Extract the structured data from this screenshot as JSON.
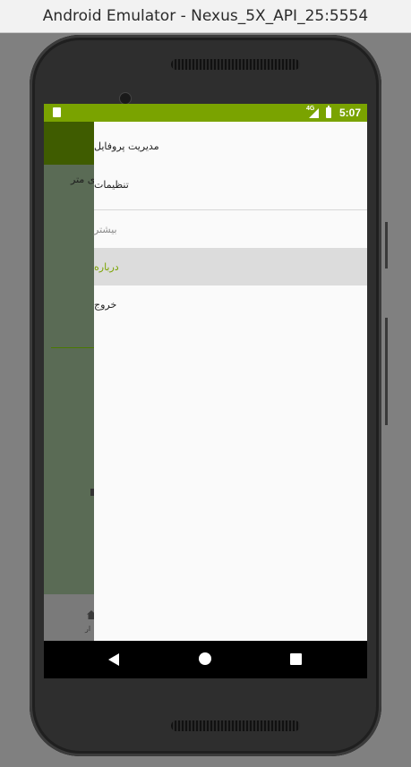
{
  "window": {
    "title": "Android Emulator - Nexus_5X_API_25:5554"
  },
  "status_bar": {
    "time": "5:07",
    "network": "4G",
    "icons": [
      "sd-card-icon",
      "signal-icon",
      "battery-icon"
    ]
  },
  "background_app": {
    "partial_text": "ی متر",
    "bottom_nav_partial_label": "ار"
  },
  "drawer": {
    "items": [
      {
        "label": "مدیریت پروفایل"
      },
      {
        "label": "تنظیمات"
      },
      {
        "label": "بیشتر"
      },
      {
        "label": "درباره"
      },
      {
        "label": "خروج"
      }
    ]
  },
  "colors": {
    "status_bar": "#7aa300",
    "app_header": "#3f5c00",
    "accent": "#7aa300",
    "active_row": "#dcdcdc"
  },
  "nav_bar": {
    "buttons": [
      "back-icon",
      "home-icon",
      "recents-icon"
    ]
  }
}
